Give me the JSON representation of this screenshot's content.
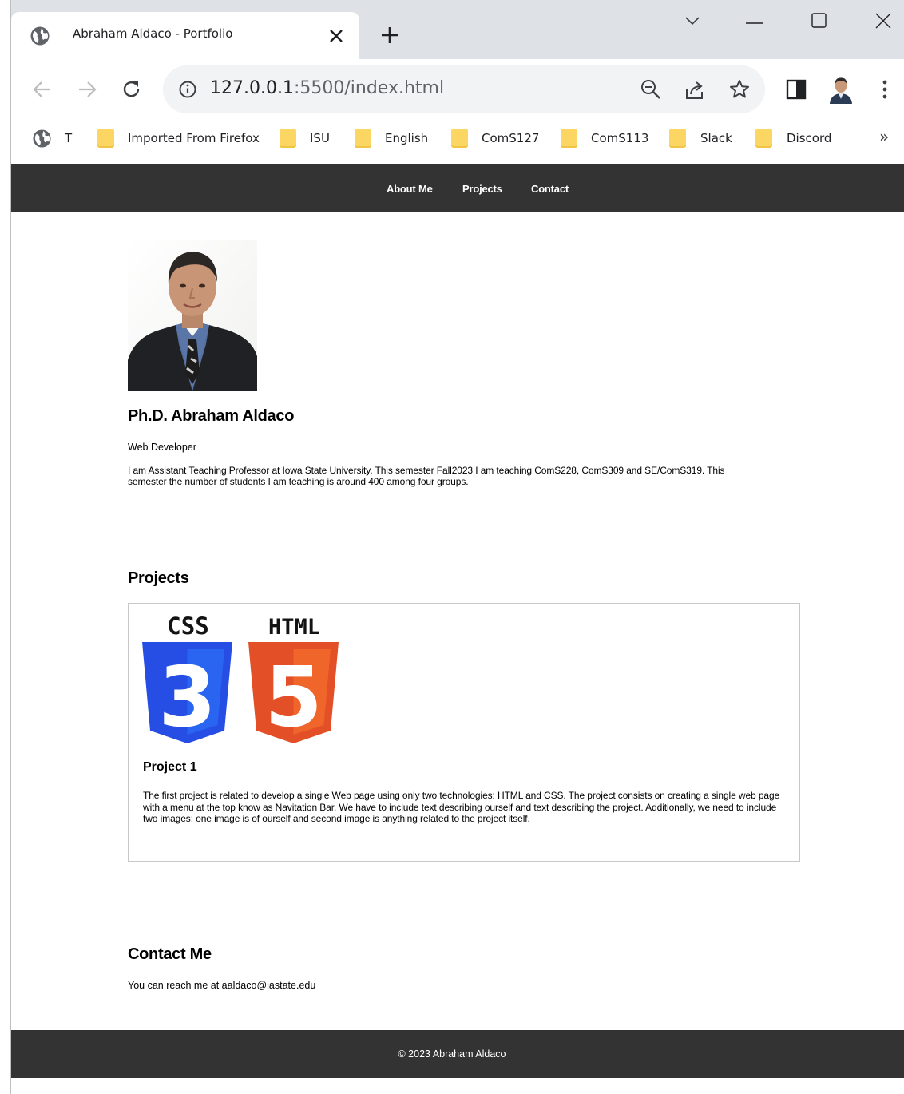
{
  "browser": {
    "tab_title": "Abraham Aldaco - Portfolio",
    "url_host": "127.0.0.1",
    "url_path": ":5500/index.html",
    "bookmarks": [
      {
        "label": "T",
        "icon": "globe-icon"
      },
      {
        "label": "Imported From Firefox",
        "icon": "folder-icon"
      },
      {
        "label": "ISU",
        "icon": "folder-icon"
      },
      {
        "label": "English",
        "icon": "folder-icon"
      },
      {
        "label": "ComS127",
        "icon": "folder-icon"
      },
      {
        "label": "ComS113",
        "icon": "folder-icon"
      },
      {
        "label": "Slack",
        "icon": "folder-icon"
      },
      {
        "label": "Discord",
        "icon": "folder-icon"
      }
    ],
    "more_bookmarks": "»"
  },
  "nav": {
    "about": "About Me",
    "projects": "Projects",
    "contact": "Contact"
  },
  "about": {
    "name": "Ph.D. Abraham Aldaco",
    "role": "Web Developer",
    "bio": "I am Assistant Teaching Professor at Iowa State University. This semester Fall2023 I am teaching ComS228, ComS309 and SE/ComS319. This semester the number of students I am teaching is around 400 among four groups."
  },
  "projects": {
    "heading": "Projects",
    "logo_css_text": "CSS",
    "logo_html_text": "HTML",
    "logo_css_number": "3",
    "logo_html_number": "5",
    "project1_title": "Project 1",
    "project1_desc": "The first project is related to develop a single Web page using only two technologies: HTML and CSS. The project consists on creating a single web page with a menu at the top know as Navitation Bar. We have to include text describing ourself and text describing the project. Additionally, we need to include two images: one image is of ourself and second image is anything related to the project itself."
  },
  "contact": {
    "heading": "Contact Me",
    "text": "You can reach me at aaldaco@iastate.edu"
  },
  "footer": {
    "text": "© 2023 Abraham Aldaco"
  },
  "colors": {
    "nav_bg": "#333333",
    "css_blue": "#264de4",
    "html_orange": "#e34f26",
    "bookmark_folder": "#fcd663"
  }
}
